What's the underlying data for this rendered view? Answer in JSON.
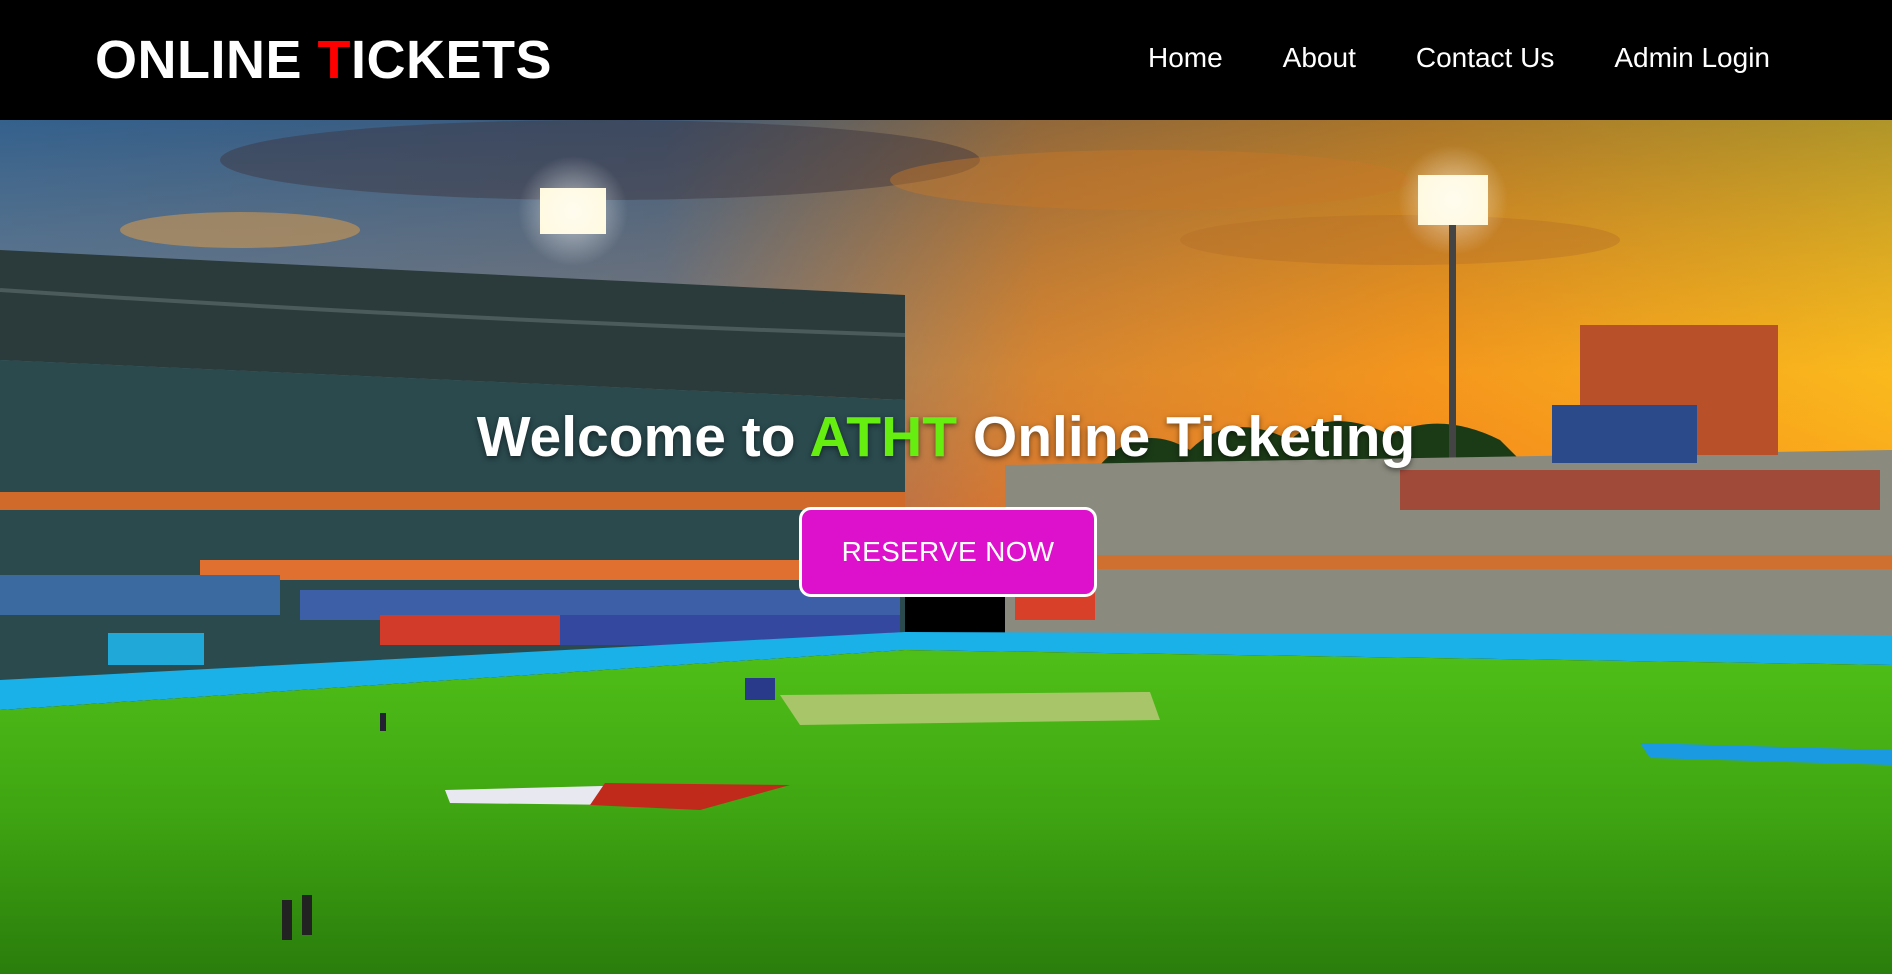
{
  "header": {
    "brand_part1": "ONLINE ",
    "brand_accent": "T",
    "brand_part2": "ICKETS",
    "nav": [
      "Home",
      "About",
      "Contact Us",
      "Admin Login"
    ]
  },
  "hero": {
    "headline_before": "Welcome to ",
    "headline_highlight": "ATHT",
    "headline_after": " Online Ticketing",
    "cta_label": "RESERVE NOW",
    "background_scene": "cricket-stadium-at-sunset"
  },
  "colors": {
    "brand_accent": "#ff0000",
    "highlight_green": "#66ee11",
    "cta_background": "#dd11cc",
    "header_background": "#000000"
  }
}
